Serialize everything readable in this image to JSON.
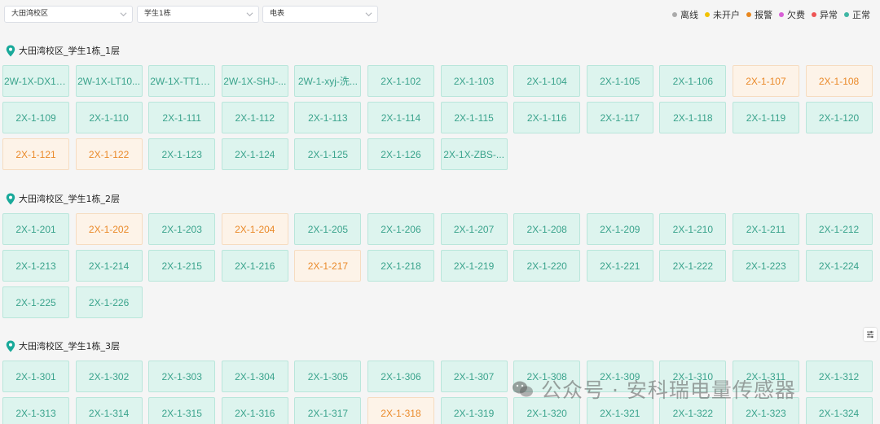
{
  "filters": {
    "campus": "大田湾校区",
    "building": "学生1栋",
    "meter_type": "电表"
  },
  "legend": [
    {
      "label": "离线",
      "color": "#aaaaaa"
    },
    {
      "label": "未开户",
      "color": "#f2c200"
    },
    {
      "label": "报警",
      "color": "#e8871e"
    },
    {
      "label": "欠费",
      "color": "#d860d6"
    },
    {
      "label": "异常",
      "color": "#ee5555"
    },
    {
      "label": "正常",
      "color": "#3fb6a4"
    }
  ],
  "floors": [
    {
      "title": "大田湾校区_学生1栋_1层",
      "rooms": [
        {
          "name": "2W-1X-DX10...",
          "status": "normal"
        },
        {
          "name": "2W-1X-LT10...",
          "status": "normal"
        },
        {
          "name": "2W-1X-TT10...",
          "status": "normal"
        },
        {
          "name": "2W-1X-SHJ-...",
          "status": "normal"
        },
        {
          "name": "2W-1-xyj-洗...",
          "status": "normal"
        },
        {
          "name": "2X-1-102",
          "status": "normal"
        },
        {
          "name": "2X-1-103",
          "status": "normal"
        },
        {
          "name": "2X-1-104",
          "status": "normal"
        },
        {
          "name": "2X-1-105",
          "status": "normal"
        },
        {
          "name": "2X-1-106",
          "status": "normal"
        },
        {
          "name": "2X-1-107",
          "status": "alarm"
        },
        {
          "name": "2X-1-108",
          "status": "alarm"
        },
        {
          "name": "2X-1-109",
          "status": "normal"
        },
        {
          "name": "2X-1-110",
          "status": "normal"
        },
        {
          "name": "2X-1-111",
          "status": "normal"
        },
        {
          "name": "2X-1-112",
          "status": "normal"
        },
        {
          "name": "2X-1-113",
          "status": "normal"
        },
        {
          "name": "2X-1-114",
          "status": "normal"
        },
        {
          "name": "2X-1-115",
          "status": "normal"
        },
        {
          "name": "2X-1-116",
          "status": "normal"
        },
        {
          "name": "2X-1-117",
          "status": "normal"
        },
        {
          "name": "2X-1-118",
          "status": "normal"
        },
        {
          "name": "2X-1-119",
          "status": "normal"
        },
        {
          "name": "2X-1-120",
          "status": "normal"
        },
        {
          "name": "2X-1-121",
          "status": "alarm"
        },
        {
          "name": "2X-1-122",
          "status": "alarm"
        },
        {
          "name": "2X-1-123",
          "status": "normal"
        },
        {
          "name": "2X-1-124",
          "status": "normal"
        },
        {
          "name": "2X-1-125",
          "status": "normal"
        },
        {
          "name": "2X-1-126",
          "status": "normal"
        },
        {
          "name": "2X-1X-ZBS-...",
          "status": "normal"
        }
      ]
    },
    {
      "title": "大田湾校区_学生1栋_2层",
      "rooms": [
        {
          "name": "2X-1-201",
          "status": "normal"
        },
        {
          "name": "2X-1-202",
          "status": "alarm"
        },
        {
          "name": "2X-1-203",
          "status": "normal"
        },
        {
          "name": "2X-1-204",
          "status": "alarm"
        },
        {
          "name": "2X-1-205",
          "status": "normal"
        },
        {
          "name": "2X-1-206",
          "status": "normal"
        },
        {
          "name": "2X-1-207",
          "status": "normal"
        },
        {
          "name": "2X-1-208",
          "status": "normal"
        },
        {
          "name": "2X-1-209",
          "status": "normal"
        },
        {
          "name": "2X-1-210",
          "status": "normal"
        },
        {
          "name": "2X-1-211",
          "status": "normal"
        },
        {
          "name": "2X-1-212",
          "status": "normal"
        },
        {
          "name": "2X-1-213",
          "status": "normal"
        },
        {
          "name": "2X-1-214",
          "status": "normal"
        },
        {
          "name": "2X-1-215",
          "status": "normal"
        },
        {
          "name": "2X-1-216",
          "status": "normal"
        },
        {
          "name": "2X-1-217",
          "status": "alarm"
        },
        {
          "name": "2X-1-218",
          "status": "normal"
        },
        {
          "name": "2X-1-219",
          "status": "normal"
        },
        {
          "name": "2X-1-220",
          "status": "normal"
        },
        {
          "name": "2X-1-221",
          "status": "normal"
        },
        {
          "name": "2X-1-222",
          "status": "normal"
        },
        {
          "name": "2X-1-223",
          "status": "normal"
        },
        {
          "name": "2X-1-224",
          "status": "normal"
        },
        {
          "name": "2X-1-225",
          "status": "normal"
        },
        {
          "name": "2X-1-226",
          "status": "normal"
        }
      ]
    },
    {
      "title": "大田湾校区_学生1栋_3层",
      "rooms": [
        {
          "name": "2X-1-301",
          "status": "normal"
        },
        {
          "name": "2X-1-302",
          "status": "normal"
        },
        {
          "name": "2X-1-303",
          "status": "normal"
        },
        {
          "name": "2X-1-304",
          "status": "normal"
        },
        {
          "name": "2X-1-305",
          "status": "normal"
        },
        {
          "name": "2X-1-306",
          "status": "normal"
        },
        {
          "name": "2X-1-307",
          "status": "normal"
        },
        {
          "name": "2X-1-308",
          "status": "normal"
        },
        {
          "name": "2X-1-309",
          "status": "normal"
        },
        {
          "name": "2X-1-310",
          "status": "normal"
        },
        {
          "name": "2X-1-311",
          "status": "normal"
        },
        {
          "name": "2X-1-312",
          "status": "normal"
        },
        {
          "name": "2X-1-313",
          "status": "normal"
        },
        {
          "name": "2X-1-314",
          "status": "normal"
        },
        {
          "name": "2X-1-315",
          "status": "normal"
        },
        {
          "name": "2X-1-316",
          "status": "normal"
        },
        {
          "name": "2X-1-317",
          "status": "normal"
        },
        {
          "name": "2X-1-318",
          "status": "alarm"
        },
        {
          "name": "2X-1-319",
          "status": "normal"
        },
        {
          "name": "2X-1-320",
          "status": "normal"
        },
        {
          "name": "2X-1-321",
          "status": "normal"
        },
        {
          "name": "2X-1-322",
          "status": "normal"
        },
        {
          "name": "2X-1-323",
          "status": "normal"
        },
        {
          "name": "2X-1-324",
          "status": "normal"
        }
      ]
    }
  ],
  "watermark": "公众号 · 安科瑞电量传感器"
}
